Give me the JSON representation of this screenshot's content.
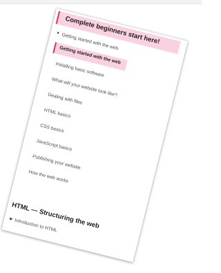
{
  "sidebar": {
    "section1": {
      "heading": "Complete beginners start here!",
      "group_label": "Getting started with the web",
      "active_item": "Getting started with the web",
      "items": [
        "Installing basic software",
        "What will your website look like?",
        "Dealing with files",
        "HTML basics",
        "CSS basics",
        "JavaScript basics",
        "Publishing your website",
        "How the web works"
      ]
    },
    "section2": {
      "heading": "HTML — Structuring the web",
      "group_label": "Introduction to HTML"
    }
  },
  "colors": {
    "highlight_bg": "#fad1e0",
    "highlight_border": "#d6336c"
  },
  "icons": {
    "expanded": "triangle-down",
    "collapsed": "triangle-right"
  }
}
